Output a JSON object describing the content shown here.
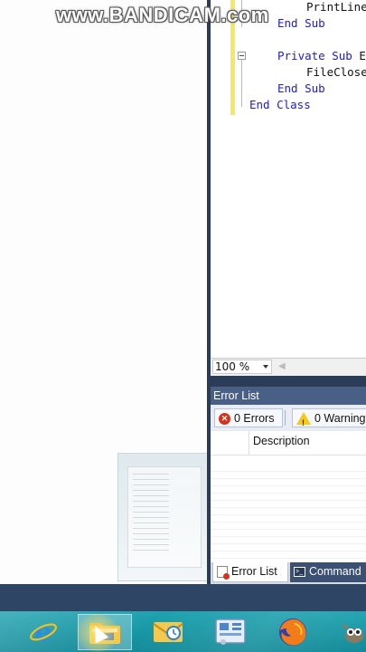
{
  "watermark": "www.BANDICAM.com",
  "editor": {
    "lines": {
      "l1": "PrintLine",
      "l2_kw": "End Sub",
      "l3_kw": "Private Sub",
      "l3_tx": " E",
      "l4": "FileClose",
      "l5_kw": "End Sub",
      "l6_kw": "End Class"
    },
    "zoom": "100 %"
  },
  "error_list": {
    "title": "Error List",
    "errors_label": "0 Errors",
    "warnings_label": "0 Warning",
    "column_description": "Description",
    "error_icon_glyph": "✕"
  },
  "bottom_tabs": {
    "error_list": "Error List",
    "command": "Command"
  },
  "taskbar": {
    "items": [
      "internet-explorer",
      "file-explorer",
      "outlook",
      "control-panel",
      "firefox",
      "gimp"
    ]
  },
  "colors": {
    "accent": "#4a5f85",
    "taskbar": "#1ea3b0",
    "keyword": "#1c1cd0"
  }
}
